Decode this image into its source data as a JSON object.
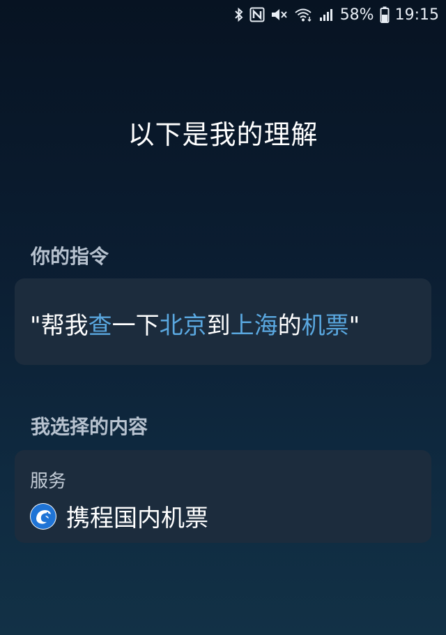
{
  "status_bar": {
    "icons": [
      "bluetooth-icon",
      "nfc-icon",
      "mute-icon",
      "wifi-icon",
      "signal-icon"
    ],
    "battery_percent": "58%",
    "time": "19:15"
  },
  "title": "以下是我的理解",
  "command_section": {
    "label": "你的指令",
    "segments": {
      "s1": "\"帮我",
      "s2": "查",
      "s3": "一下",
      "s4": "北京",
      "s5": "到",
      "s6": "上海",
      "s7": "的",
      "s8": "机票",
      "s9": "\""
    },
    "highlight_color": "#5aa8e0"
  },
  "selection_section": {
    "label": "我选择的内容",
    "service_label": "服务",
    "service_name": "携程国内机票",
    "service_icon": "ctrip-dolphin-icon"
  }
}
